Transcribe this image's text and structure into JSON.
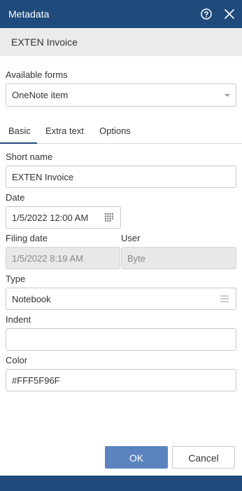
{
  "window": {
    "title": "Metadata",
    "help_icon": "help-circle-icon",
    "close_icon": "close-icon"
  },
  "document": {
    "title": "EXTEN Invoice"
  },
  "available_forms": {
    "label": "Available forms",
    "value": "OneNote item"
  },
  "tabs": [
    {
      "label": "Basic",
      "active": true
    },
    {
      "label": "Extra text",
      "active": false
    },
    {
      "label": "Options",
      "active": false
    }
  ],
  "form": {
    "short_name": {
      "label": "Short name",
      "value": "EXTEN Invoice"
    },
    "date": {
      "label": "Date",
      "value": "1/5/2022 12:00 AM"
    },
    "filing_date": {
      "label": "Filing date",
      "value": "1/5/2022 8:19 AM"
    },
    "user": {
      "label": "User",
      "value": "Byte"
    },
    "type": {
      "label": "Type",
      "value": "Notebook"
    },
    "indent": {
      "label": "Indent",
      "value": ""
    },
    "color": {
      "label": "Color",
      "value": "#FFF5F96F"
    }
  },
  "buttons": {
    "ok": "OK",
    "cancel": "Cancel"
  },
  "colors": {
    "header": "#1e4a7c",
    "primary_button": "#5b84bf",
    "doc_bar": "#ebebeb"
  }
}
